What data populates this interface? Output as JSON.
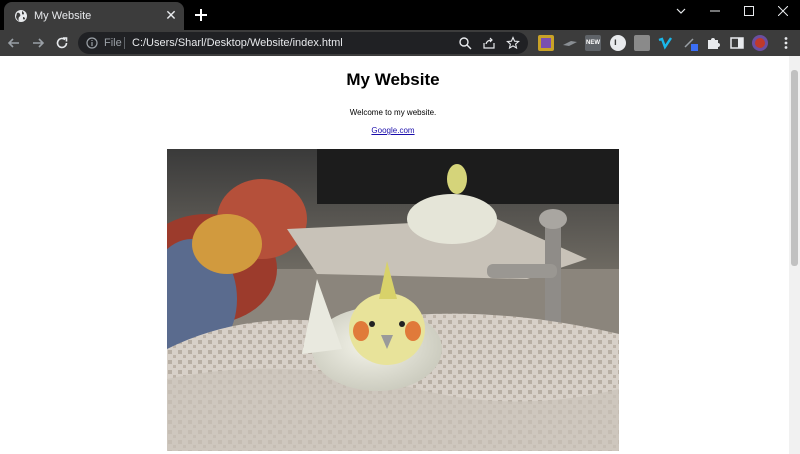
{
  "browser": {
    "tab": {
      "title": "My Website",
      "icon": "globe-icon"
    },
    "window_controls": [
      "tab-search-icon",
      "minimize-icon",
      "maximize-icon",
      "close-window-icon"
    ],
    "address_bar": {
      "scheme": "File",
      "url": "C:/Users/Sharl/Desktop/Website/index.html"
    },
    "extensions": {
      "new_badge": "NEW"
    }
  },
  "page": {
    "heading": "My Website",
    "welcome": "Welcome to my website.",
    "link_text": "Google.com",
    "image_subject": "cockatiel on a towel"
  },
  "colors": {
    "chrome_dark": "#000000",
    "toolbar": "#3c3c3c",
    "omnibox": "#202124",
    "link": "#1a0dab"
  }
}
